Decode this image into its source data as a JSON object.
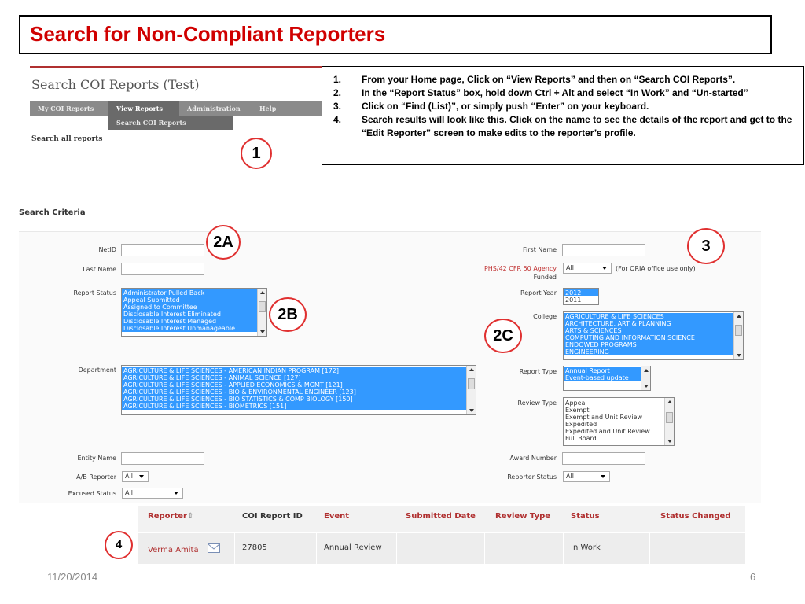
{
  "slide": {
    "title": "Search for Non-Compliant Reporters",
    "date": "11/20/2014",
    "page_number": "6"
  },
  "app": {
    "title": "Search COI Reports (Test)",
    "nav": [
      "My COI Reports",
      "View Reports",
      "Administration",
      "Help"
    ],
    "subnav": "Search COI Reports",
    "search_all": "Search all reports"
  },
  "instructions": [
    {
      "num": "1.",
      "text": "From your Home page, Click on “View Reports” and then on “Search COI Reports”."
    },
    {
      "num": "2.",
      "text": " In the “Report Status” box, hold down Ctrl + Alt and select “In Work” and “Un-started”"
    },
    {
      "num": "3.",
      "text": "Click on “Find (List)”, or simply push “Enter” on your keyboard."
    },
    {
      "num": "4.",
      "text": "Search results will look like this. Click on the name to see the details of the report and get to the “Edit Reporter” screen to make edits to the reporter’s profile."
    }
  ],
  "callouts": {
    "c1": "1",
    "c2a": "2A",
    "c2b": "2B",
    "c2c": "2C",
    "c3": "3",
    "c4": "4"
  },
  "criteria": {
    "heading": "Search Criteria",
    "labels": {
      "netid": "NetID",
      "last_name": "Last Name",
      "report_status": "Report Status",
      "department": "Department",
      "entity_name": "Entity Name",
      "ab_reporter": "A/B Reporter",
      "excused_status": "Excused Status",
      "first_name": "First Name",
      "phs": "PHS/42 CFR 50 Agency",
      "funded": "Funded",
      "report_year": "Report Year",
      "college": "College",
      "report_type": "Report Type",
      "review_type": "Review Type",
      "award_number": "Award Number",
      "reporter_status": "Reporter Status"
    },
    "phs_value": "All",
    "phs_note": "(For ORIA office use only)",
    "ab_value": "All",
    "excused_value": "All",
    "reporter_status_value": "All",
    "report_status_options": [
      "Administrator Pulled Back",
      "Appeal Submitted",
      "Assigned to Committee",
      "Disclosable Interest Eliminated",
      "Disclosable Interest Managed",
      "Disclosable Interest Unmanageable"
    ],
    "department_options": [
      "AGRICULTURE & LIFE SCIENCES - AMERICAN INDIAN PROGRAM [172]",
      "AGRICULTURE & LIFE SCIENCES - ANIMAL SCIENCE [127]",
      "AGRICULTURE & LIFE SCIENCES - APPLIED ECONOMICS & MGMT [121]",
      "AGRICULTURE & LIFE SCIENCES - BIO & ENVIRONMENTAL ENGINEER [123]",
      "AGRICULTURE & LIFE SCIENCES - BIO STATISTICS & COMP BIOLOGY [150]",
      "AGRICULTURE & LIFE SCIENCES - BIOMETRICS [151]"
    ],
    "report_year_options": [
      "2012",
      "2011"
    ],
    "college_options": [
      "AGRICULTURE & LIFE SCIENCES",
      "ARCHITECTURE, ART & PLANNING",
      "ARTS & SCIENCES",
      "COMPUTING AND INFORMATION SCIENCE",
      "ENDOWED PROGRAMS",
      "ENGINEERING"
    ],
    "report_type_options": [
      "Annual Report",
      "Event-based update"
    ],
    "review_type_options": [
      "Appeal",
      "Exempt",
      "Exempt and Unit Review",
      "Expedited",
      "Expedited and Unit Review",
      "Full Board"
    ]
  },
  "results": {
    "headers": [
      "Reporter",
      "COI Report ID",
      "Event",
      "Submitted Date",
      "Review Type",
      "Status",
      "Status Changed"
    ],
    "row": {
      "reporter": "Verma Amita",
      "report_id": "27805",
      "event": "Annual Review",
      "submitted": "",
      "review_type": "",
      "status": "In Work",
      "status_changed": ""
    }
  }
}
